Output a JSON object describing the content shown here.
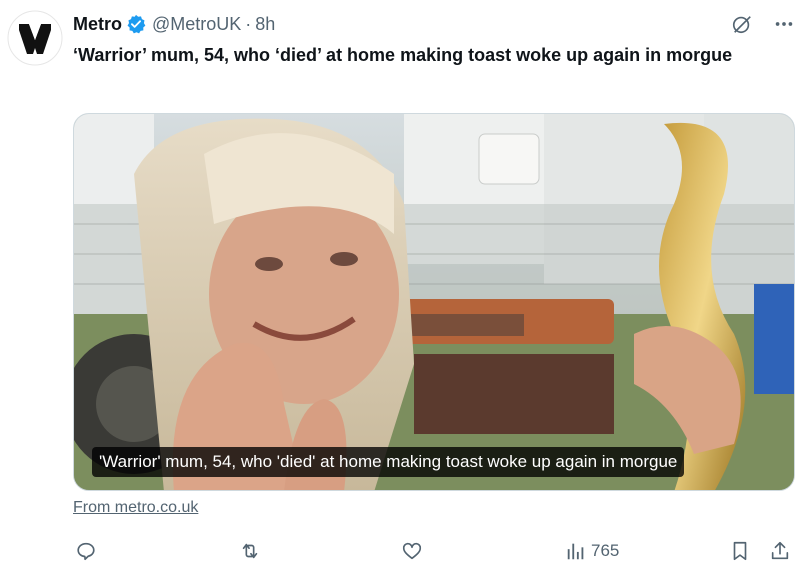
{
  "author": {
    "name": "Metro",
    "handle": "@MetroUK",
    "separator": "·",
    "time": "8h",
    "verified_color": "#1d9bf0"
  },
  "tweet": {
    "text": "‘Warrior’ mum, 54, who ‘died’ at home making toast woke up again in morgue"
  },
  "card": {
    "caption": "'Warrior' mum, 54, who 'died' at home making toast woke up again in morgue",
    "source": "From metro.co.uk"
  },
  "actions": {
    "views": "765"
  },
  "colors": {
    "text": "#0f1419",
    "muted": "#536471",
    "border": "#cfd9de"
  }
}
